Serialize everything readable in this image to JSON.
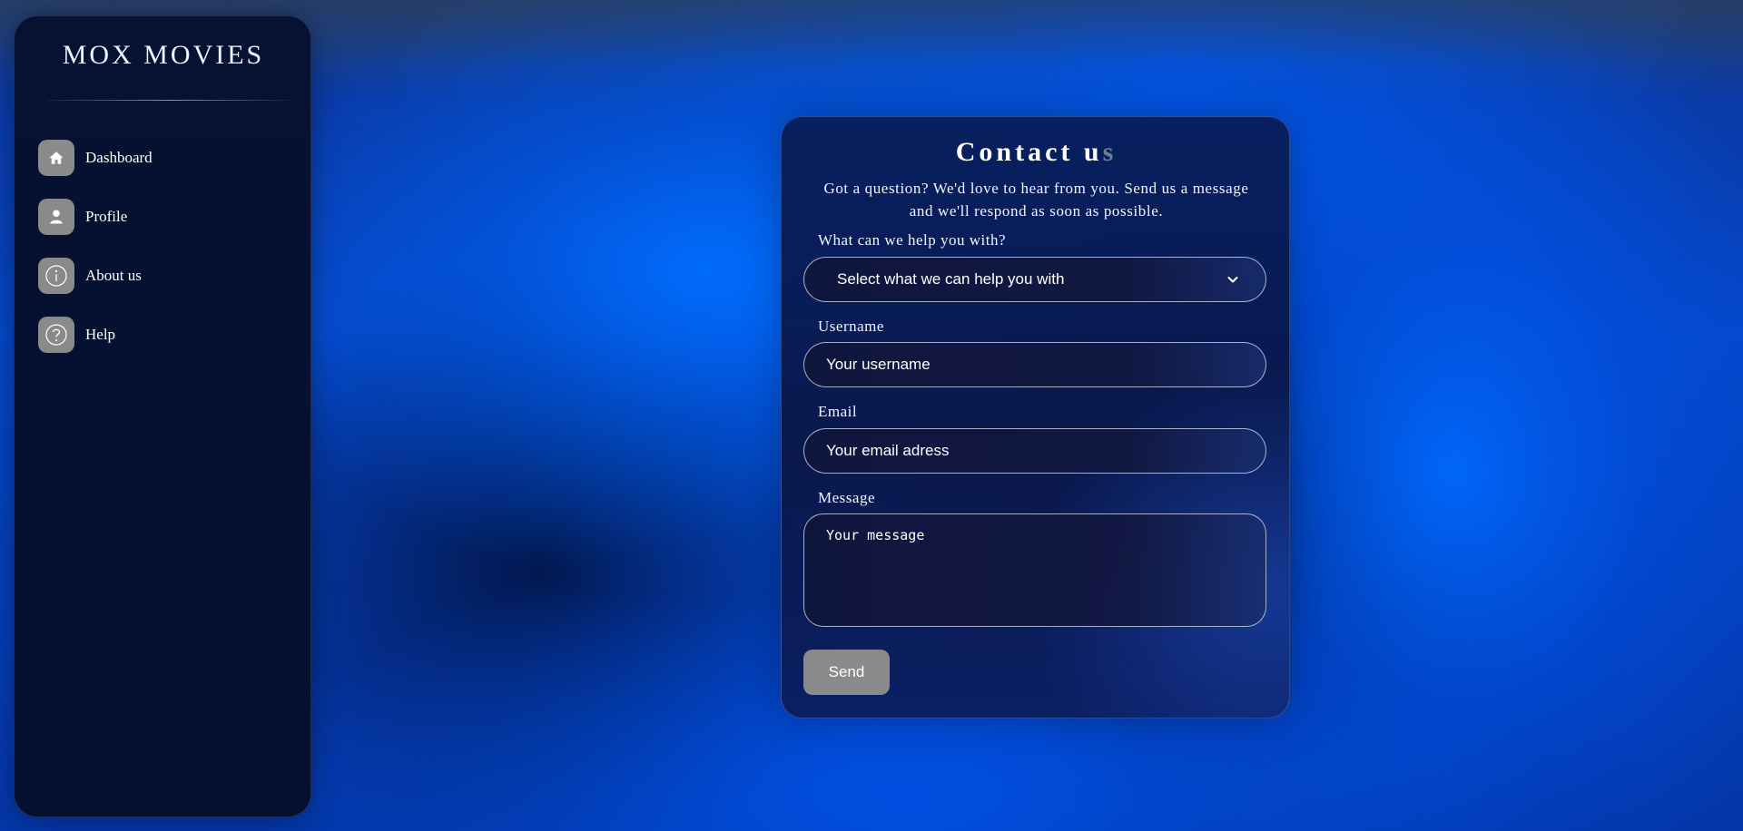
{
  "sidebar": {
    "brand": "MOX MOVIES",
    "items": [
      {
        "label": "Dashboard",
        "icon": "home-icon"
      },
      {
        "label": "Profile",
        "icon": "user-icon"
      },
      {
        "label": "About us",
        "icon": "info-icon"
      },
      {
        "label": "Help",
        "icon": "help-icon"
      }
    ]
  },
  "contact": {
    "title_main": "Contact u",
    "title_fade": "s",
    "subtitle": "Got a question? We'd love to hear from you. Send us a message and we'll respond as soon as possible.",
    "topic_label": "What can we help you with?",
    "topic_selected": "Select what we can help you with",
    "username_label": "Username",
    "username_placeholder": "Your username",
    "email_label": "Email",
    "email_placeholder": "Your email adress",
    "message_label": "Message",
    "message_placeholder": "Your message",
    "send_label": "Send"
  },
  "colors": {
    "sidebar_bg": "#061030",
    "icon_bg": "#8a8a8a",
    "button_bg": "#8a8a8a",
    "accent_blue": "#0066ff"
  }
}
